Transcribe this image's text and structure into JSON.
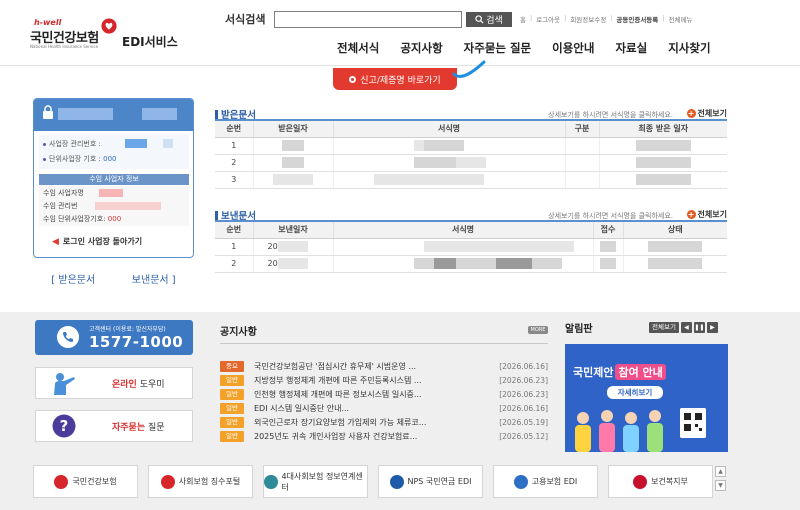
{
  "header": {
    "logo": {
      "hwell": "h-well",
      "name": "국민건강보험",
      "sub": "National Health Insurance Service",
      "service": "EDI서비스"
    },
    "search": {
      "label": "서식검색",
      "placeholder": "",
      "button": "검색"
    },
    "util_links": [
      "홈",
      "로그아웃",
      "회원정보수정",
      "공동인증서등록",
      "전체메뉴"
    ],
    "gnb": [
      "전체서식",
      "공지사항",
      "자주묻는 질문",
      "이용안내",
      "자료실",
      "지사찾기"
    ],
    "quick_report": "신고/제증명 바로가기"
  },
  "login": {
    "mgmt_no_label": "사업장 관리번호 :",
    "unit_no_label": "단위사업장 기호 :",
    "unit_no_value": "000",
    "recv_title": "수임 사업자 정보",
    "recv_name_label": "수임 사업자명",
    "recv_mgmt_label": "수임 관리번",
    "recv_unit_label": "수임 단위사업장기호:",
    "recv_unit_value": "000",
    "back_link": "로그인 사업장 돌아가기"
  },
  "side_tabs": [
    "받은문서",
    "보낸문서"
  ],
  "received": {
    "title": "받은문서",
    "hint": "상세보기를 하시려면 서식명을 클릭하세요.",
    "more": "전체보기",
    "columns": [
      "순번",
      "받은일자",
      "서식명",
      "구분",
      "최종 받은 일자"
    ],
    "rows": [
      "1",
      "2",
      "3"
    ]
  },
  "sent": {
    "title": "보낸문서",
    "hint": "상세보기를 하시려면 서식명을 클릭하세요.",
    "more": "전체보기",
    "columns": [
      "순번",
      "보낸일자",
      "서식명",
      "접수",
      "상태"
    ],
    "rows": [
      {
        "no": "1",
        "date": "20"
      },
      {
        "no": "2",
        "date": "20"
      }
    ]
  },
  "customer_center": {
    "label": "고객센터 (이용료: 발신자부담)",
    "number": "1577-1000"
  },
  "online_help": {
    "prefix": "온라인",
    "suffix": " 도우미"
  },
  "faq_btn": {
    "prefix": "자주묻는",
    "suffix": " 질문"
  },
  "notice": {
    "title": "공지사항",
    "more": "MORE",
    "items": [
      {
        "tag": "중요",
        "type": "imp",
        "text": "국민건강보험공단 '점심시간 휴무제' 시범운영 ...",
        "date": "[2026.06.16]"
      },
      {
        "tag": "일반",
        "type": "gen",
        "text": "지방정부 행정체계 개편에 따른 주민등록시스템 ...",
        "date": "[2026.06.23]"
      },
      {
        "tag": "일반",
        "type": "gen",
        "text": "인천형 행정체제 개편에 따른 정보시스템 일시중...",
        "date": "[2026.06.23]"
      },
      {
        "tag": "일반",
        "type": "gen",
        "text": "EDI 시스템 일시중단 안내...",
        "date": "[2026.06.16]"
      },
      {
        "tag": "일반",
        "type": "gen",
        "text": "외국인근로자 장기요양보험 가입제외 가능 체류코...",
        "date": "[2026.05.19]"
      },
      {
        "tag": "일반",
        "type": "gen",
        "text": "2025년도 귀속 개인사업장 사용자 건강보험료...",
        "date": "[2026.05.12]"
      }
    ]
  },
  "board": {
    "title": "알림판",
    "all": "전체보기",
    "banner_head": "국민제안",
    "banner_pill": "참여 안내",
    "banner_sub": "자세히보기"
  },
  "partners": [
    {
      "name": "국민건강보험",
      "color": "#d6262b"
    },
    {
      "name": "사회보험 징수포털",
      "color": "#d6262b"
    },
    {
      "name": "4대사회보험 정보연계센터",
      "color": "#2f8a9a"
    },
    {
      "name": "NPS 국민연금 EDI",
      "color": "#1f5aa8"
    },
    {
      "name": "고용보험 EDI",
      "color": "#2c6fc4"
    },
    {
      "name": "보건복지부",
      "color": "#c8102e"
    }
  ],
  "colors": {
    "brand_blue": "#3d78c2",
    "accent_red": "#e23a2f",
    "tag_important": "#e4672b",
    "tag_general": "#f4a12a"
  }
}
